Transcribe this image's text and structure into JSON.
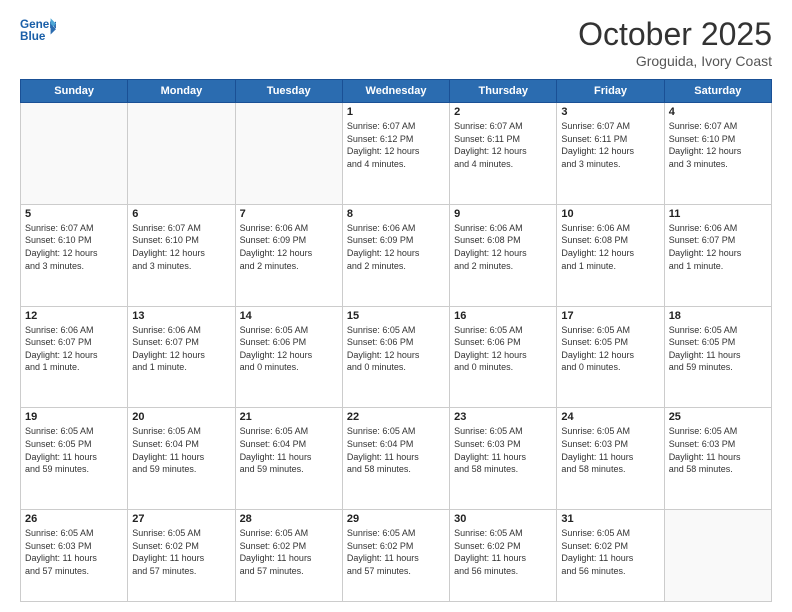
{
  "header": {
    "logo_line1": "General",
    "logo_line2": "Blue",
    "month": "October 2025",
    "location": "Groguida, Ivory Coast"
  },
  "weekdays": [
    "Sunday",
    "Monday",
    "Tuesday",
    "Wednesday",
    "Thursday",
    "Friday",
    "Saturday"
  ],
  "weeks": [
    [
      {
        "day": "",
        "info": ""
      },
      {
        "day": "",
        "info": ""
      },
      {
        "day": "",
        "info": ""
      },
      {
        "day": "1",
        "info": "Sunrise: 6:07 AM\nSunset: 6:12 PM\nDaylight: 12 hours\nand 4 minutes."
      },
      {
        "day": "2",
        "info": "Sunrise: 6:07 AM\nSunset: 6:11 PM\nDaylight: 12 hours\nand 4 minutes."
      },
      {
        "day": "3",
        "info": "Sunrise: 6:07 AM\nSunset: 6:11 PM\nDaylight: 12 hours\nand 3 minutes."
      },
      {
        "day": "4",
        "info": "Sunrise: 6:07 AM\nSunset: 6:10 PM\nDaylight: 12 hours\nand 3 minutes."
      }
    ],
    [
      {
        "day": "5",
        "info": "Sunrise: 6:07 AM\nSunset: 6:10 PM\nDaylight: 12 hours\nand 3 minutes."
      },
      {
        "day": "6",
        "info": "Sunrise: 6:07 AM\nSunset: 6:10 PM\nDaylight: 12 hours\nand 3 minutes."
      },
      {
        "day": "7",
        "info": "Sunrise: 6:06 AM\nSunset: 6:09 PM\nDaylight: 12 hours\nand 2 minutes."
      },
      {
        "day": "8",
        "info": "Sunrise: 6:06 AM\nSunset: 6:09 PM\nDaylight: 12 hours\nand 2 minutes."
      },
      {
        "day": "9",
        "info": "Sunrise: 6:06 AM\nSunset: 6:08 PM\nDaylight: 12 hours\nand 2 minutes."
      },
      {
        "day": "10",
        "info": "Sunrise: 6:06 AM\nSunset: 6:08 PM\nDaylight: 12 hours\nand 1 minute."
      },
      {
        "day": "11",
        "info": "Sunrise: 6:06 AM\nSunset: 6:07 PM\nDaylight: 12 hours\nand 1 minute."
      }
    ],
    [
      {
        "day": "12",
        "info": "Sunrise: 6:06 AM\nSunset: 6:07 PM\nDaylight: 12 hours\nand 1 minute."
      },
      {
        "day": "13",
        "info": "Sunrise: 6:06 AM\nSunset: 6:07 PM\nDaylight: 12 hours\nand 1 minute."
      },
      {
        "day": "14",
        "info": "Sunrise: 6:05 AM\nSunset: 6:06 PM\nDaylight: 12 hours\nand 0 minutes."
      },
      {
        "day": "15",
        "info": "Sunrise: 6:05 AM\nSunset: 6:06 PM\nDaylight: 12 hours\nand 0 minutes."
      },
      {
        "day": "16",
        "info": "Sunrise: 6:05 AM\nSunset: 6:06 PM\nDaylight: 12 hours\nand 0 minutes."
      },
      {
        "day": "17",
        "info": "Sunrise: 6:05 AM\nSunset: 6:05 PM\nDaylight: 12 hours\nand 0 minutes."
      },
      {
        "day": "18",
        "info": "Sunrise: 6:05 AM\nSunset: 6:05 PM\nDaylight: 11 hours\nand 59 minutes."
      }
    ],
    [
      {
        "day": "19",
        "info": "Sunrise: 6:05 AM\nSunset: 6:05 PM\nDaylight: 11 hours\nand 59 minutes."
      },
      {
        "day": "20",
        "info": "Sunrise: 6:05 AM\nSunset: 6:04 PM\nDaylight: 11 hours\nand 59 minutes."
      },
      {
        "day": "21",
        "info": "Sunrise: 6:05 AM\nSunset: 6:04 PM\nDaylight: 11 hours\nand 59 minutes."
      },
      {
        "day": "22",
        "info": "Sunrise: 6:05 AM\nSunset: 6:04 PM\nDaylight: 11 hours\nand 58 minutes."
      },
      {
        "day": "23",
        "info": "Sunrise: 6:05 AM\nSunset: 6:03 PM\nDaylight: 11 hours\nand 58 minutes."
      },
      {
        "day": "24",
        "info": "Sunrise: 6:05 AM\nSunset: 6:03 PM\nDaylight: 11 hours\nand 58 minutes."
      },
      {
        "day": "25",
        "info": "Sunrise: 6:05 AM\nSunset: 6:03 PM\nDaylight: 11 hours\nand 58 minutes."
      }
    ],
    [
      {
        "day": "26",
        "info": "Sunrise: 6:05 AM\nSunset: 6:03 PM\nDaylight: 11 hours\nand 57 minutes."
      },
      {
        "day": "27",
        "info": "Sunrise: 6:05 AM\nSunset: 6:02 PM\nDaylight: 11 hours\nand 57 minutes."
      },
      {
        "day": "28",
        "info": "Sunrise: 6:05 AM\nSunset: 6:02 PM\nDaylight: 11 hours\nand 57 minutes."
      },
      {
        "day": "29",
        "info": "Sunrise: 6:05 AM\nSunset: 6:02 PM\nDaylight: 11 hours\nand 57 minutes."
      },
      {
        "day": "30",
        "info": "Sunrise: 6:05 AM\nSunset: 6:02 PM\nDaylight: 11 hours\nand 56 minutes."
      },
      {
        "day": "31",
        "info": "Sunrise: 6:05 AM\nSunset: 6:02 PM\nDaylight: 11 hours\nand 56 minutes."
      },
      {
        "day": "",
        "info": ""
      }
    ]
  ]
}
